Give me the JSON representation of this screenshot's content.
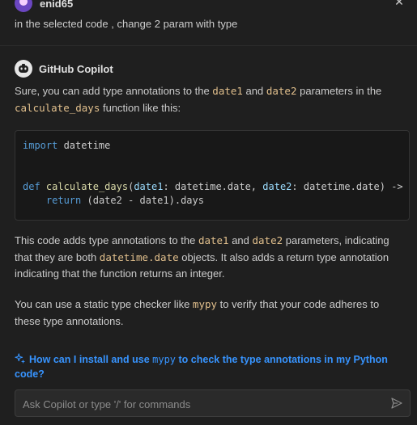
{
  "user": {
    "name": "enid65",
    "message": "in the selected code , change 2 param with type"
  },
  "copilot": {
    "name": "GitHub Copilot",
    "intro": {
      "t1": "Sure, you can add type annotations to the ",
      "c1": "date1",
      "t2": " and ",
      "c2": "date2",
      "t3": " parameters in the ",
      "c3": "calculate_days",
      "t4": " function like this:"
    },
    "code": {
      "line1": {
        "kw": "import",
        "rest": " datetime"
      },
      "line4": {
        "kw": "def",
        "fn": "calculate_days",
        "p1": "(",
        "a1": "date1",
        "t1": ": datetime.date, ",
        "a2": "date2",
        "t2": ": datetime.date) ->"
      },
      "line5": {
        "indent": "    ",
        "kw": "return",
        "rest": " (date2 - date1).days"
      }
    },
    "explain1": {
      "t1": "This code adds type annotations to the ",
      "c1": "date1",
      "t2": " and ",
      "c2": "date2",
      "t3": " parameters, indicating that they are both ",
      "c3": "datetime.date",
      "t4": " objects. It also adds a return type annotation indicating that the function returns an integer."
    },
    "explain2": {
      "t1": "You can use a static type checker like ",
      "c1": "mypy",
      "t2": " to verify that your code adheres to these type annotations."
    }
  },
  "suggestion": {
    "t1": "How can I install and use ",
    "c1": "mypy",
    "t2": " to check the type annotations in my Python code?"
  },
  "input": {
    "placeholder": "Ask Copilot or type '/' for commands"
  },
  "icons": {
    "close": "close-icon",
    "send": "send-icon",
    "sparkle": "sparkle-icon",
    "copilot": "copilot-icon"
  },
  "colors": {
    "background": "#1f1f1f",
    "link": "#3794ff",
    "inline_code": "#e2c08d"
  }
}
